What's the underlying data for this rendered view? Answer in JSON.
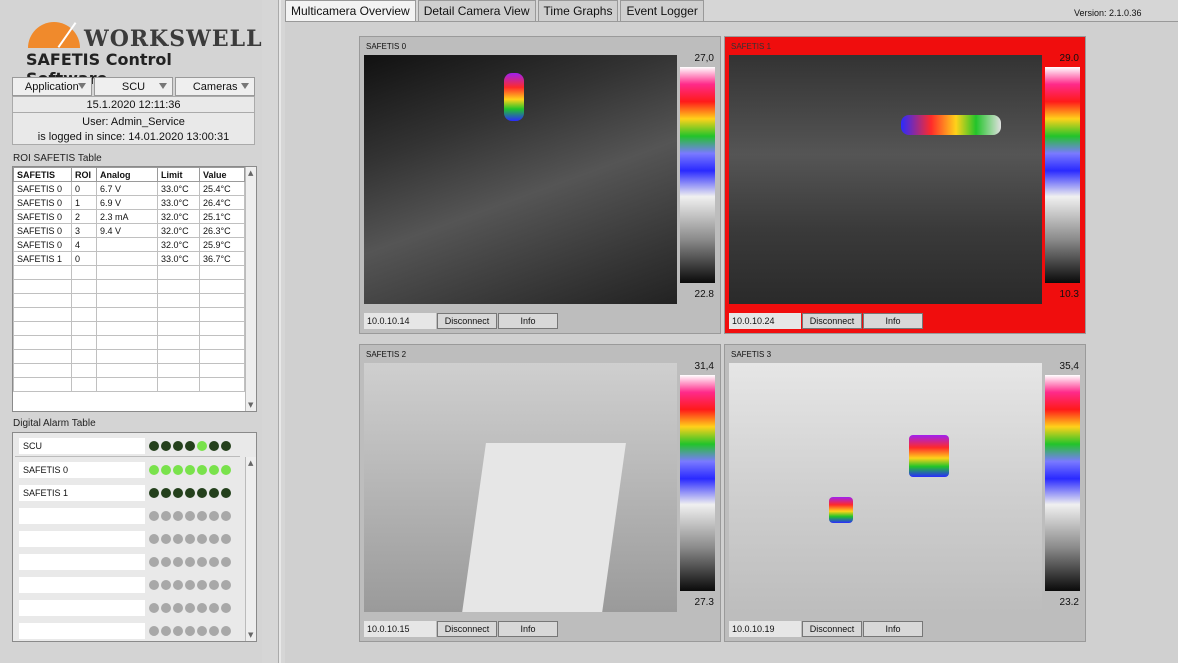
{
  "app": {
    "brand": "WORKSWELL",
    "product": "SAFETIS Control Software",
    "version": "Version: 2.1.0.36"
  },
  "menu": [
    "Application",
    "SCU",
    "Cameras"
  ],
  "session": {
    "datetime": "15.1.2020 12:11:36",
    "user": "User: Admin_Service",
    "since": "is logged in since: 14.01.2020 13:00:31"
  },
  "roi": {
    "label": "ROI SAFETIS Table",
    "headers": [
      "SAFETIS",
      "ROI",
      "Analog",
      "Limit",
      "Value"
    ],
    "rows": [
      [
        "SAFETIS 0",
        "0",
        "6.7 V",
        "33.0°C",
        "25.4°C"
      ],
      [
        "SAFETIS 0",
        "1",
        "6.9 V",
        "33.0°C",
        "26.4°C"
      ],
      [
        "SAFETIS 0",
        "2",
        "2.3 mA",
        "32.0°C",
        "25.1°C"
      ],
      [
        "SAFETIS 0",
        "3",
        "9.4 V",
        "32.0°C",
        "26.3°C"
      ],
      [
        "SAFETIS 0",
        "4",
        "",
        "32.0°C",
        "25.9°C"
      ],
      [
        "SAFETIS 1",
        "0",
        "",
        "33.0°C",
        "36.7°C"
      ]
    ],
    "empty_rows": 9
  },
  "digital": {
    "label": "Digital Alarm Table",
    "rows": [
      {
        "name": "SCU",
        "leds": [
          "dg",
          "dg",
          "dg",
          "dg",
          "bg",
          "dg",
          "dg"
        ]
      },
      {
        "name": "SAFETIS 0",
        "leds": [
          "bg",
          "bg",
          "bg",
          "bg",
          "bg",
          "bg",
          "bg"
        ]
      },
      {
        "name": "SAFETIS 1",
        "leds": [
          "dg",
          "dg",
          "dg",
          "dg",
          "dg",
          "dg",
          "dg"
        ]
      },
      {
        "name": "",
        "leds": [
          "g",
          "g",
          "g",
          "g",
          "g",
          "g",
          "g"
        ]
      },
      {
        "name": "",
        "leds": [
          "g",
          "g",
          "g",
          "g",
          "g",
          "g",
          "g"
        ]
      },
      {
        "name": "",
        "leds": [
          "g",
          "g",
          "g",
          "g",
          "g",
          "g",
          "g"
        ]
      },
      {
        "name": "",
        "leds": [
          "g",
          "g",
          "g",
          "g",
          "g",
          "g",
          "g"
        ]
      },
      {
        "name": "",
        "leds": [
          "g",
          "g",
          "g",
          "g",
          "g",
          "g",
          "g"
        ]
      },
      {
        "name": "",
        "leds": [
          "g",
          "g",
          "g",
          "g",
          "g",
          "g",
          "g"
        ]
      }
    ]
  },
  "tabs": [
    "Multicamera Overview",
    "Detail Camera View",
    "Time Graphs",
    "Event Logger"
  ],
  "cameras": [
    {
      "title": "SAFETIS 0",
      "max": "27,0",
      "min": "22.8",
      "ip": "10.0.10.14",
      "alarm": false
    },
    {
      "title": "SAFETIS 1",
      "max": "29.0",
      "min": "10.3",
      "ip": "10.0.10.24",
      "alarm": true
    },
    {
      "title": "SAFETIS 2",
      "max": "31,4",
      "min": "27.3",
      "ip": "10.0.10.15",
      "alarm": false
    },
    {
      "title": "SAFETIS 3",
      "max": "35,4",
      "min": "23.2",
      "ip": "10.0.10.19",
      "alarm": false
    }
  ],
  "buttons": {
    "disconnect": "Disconnect",
    "info": "Info"
  }
}
